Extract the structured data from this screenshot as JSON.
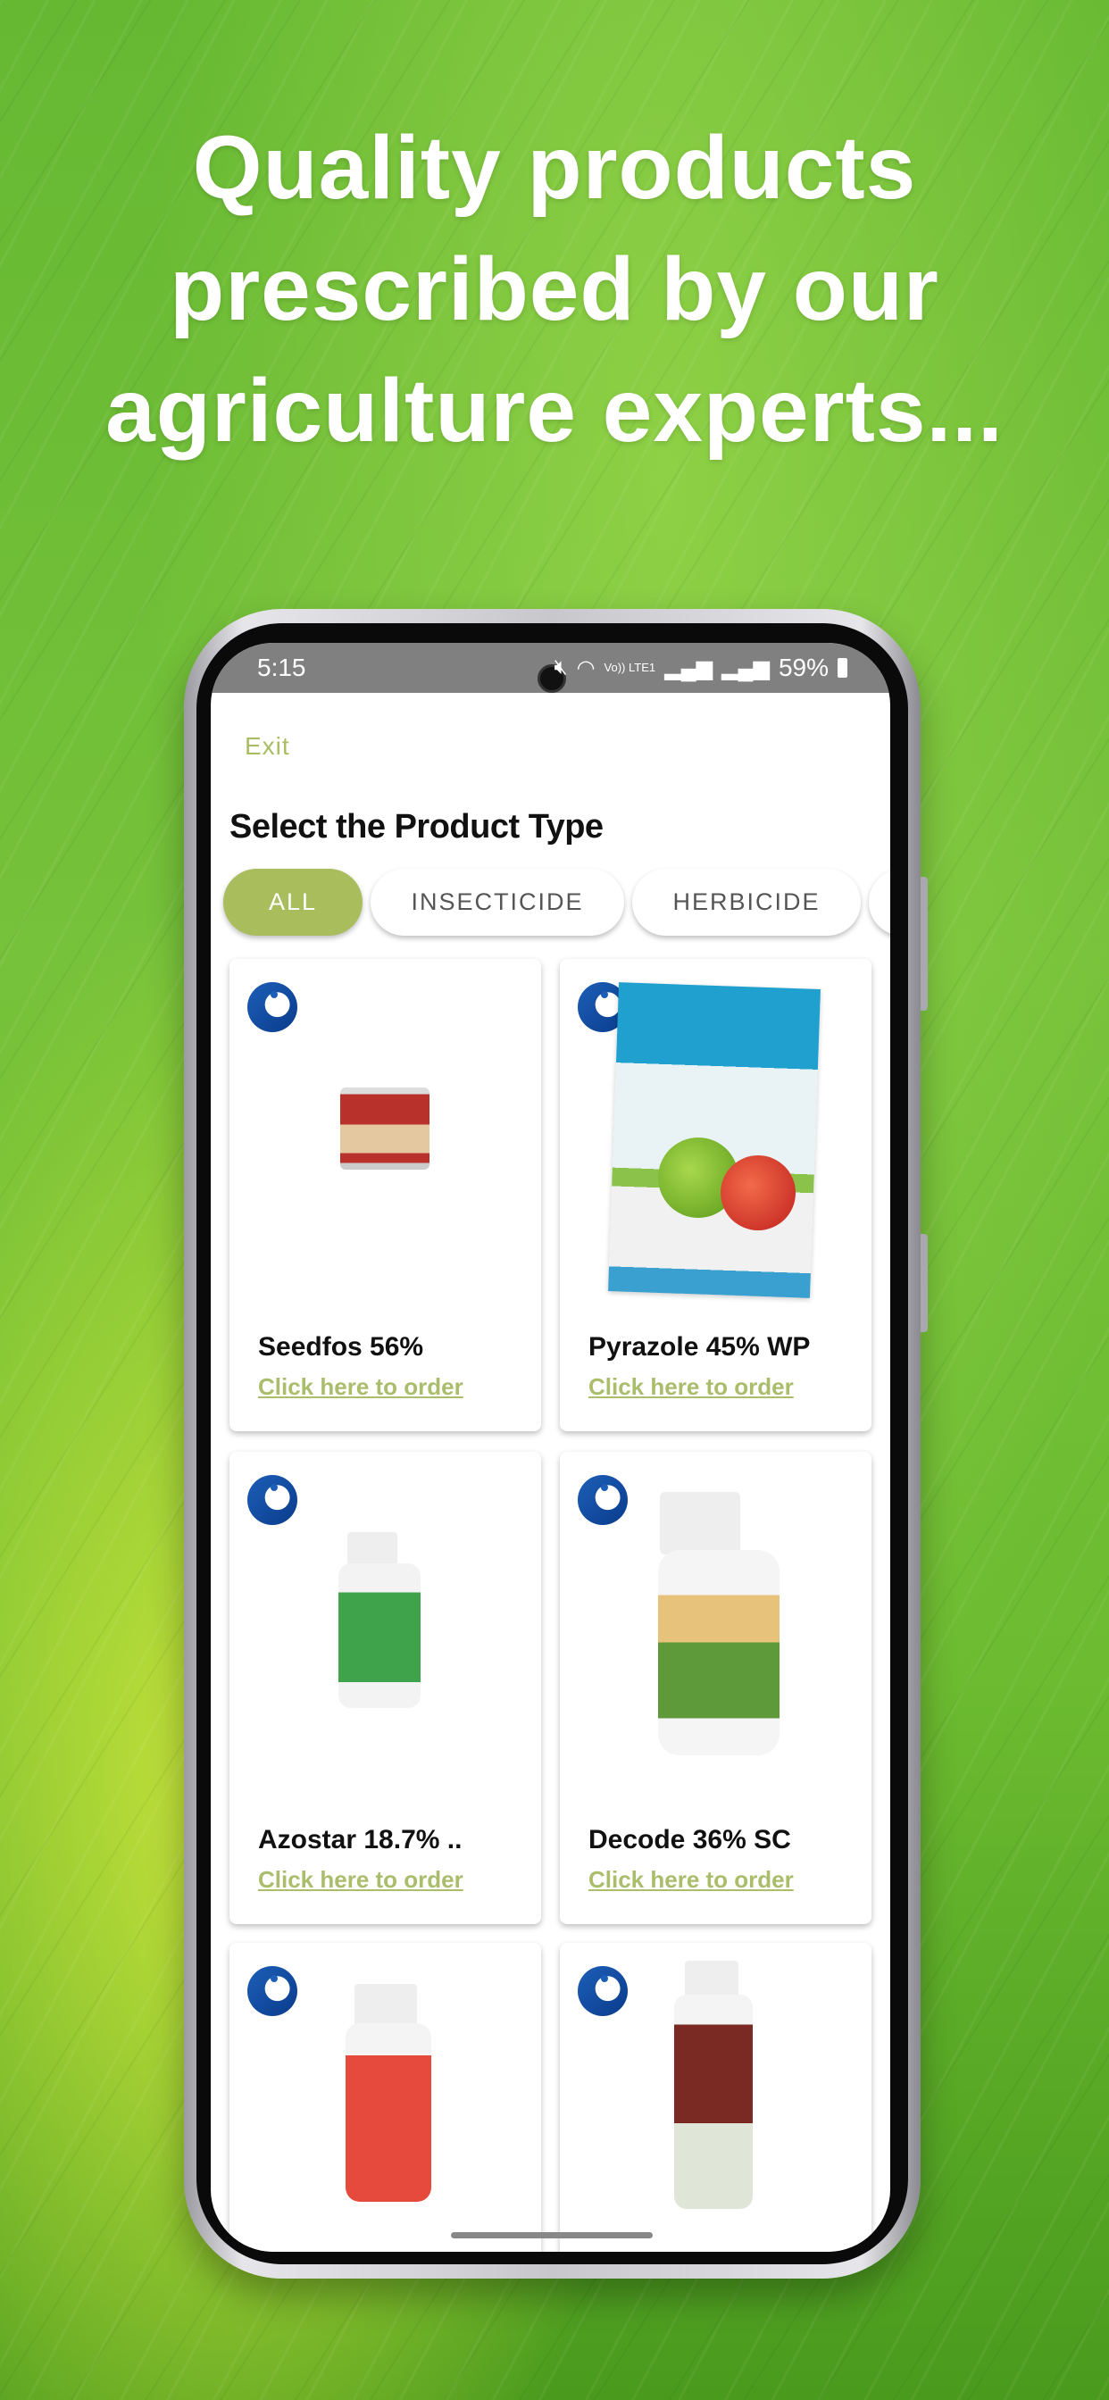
{
  "headline": [
    "Quality products",
    "prescribed by our",
    "agriculture experts..."
  ],
  "status_bar": {
    "time": "5:15",
    "network": "Vo)) LTE1",
    "battery": "59%"
  },
  "app": {
    "exit_label": "Exit",
    "title": "Select the Product Type",
    "chips": [
      {
        "label": "ALL",
        "selected": true
      },
      {
        "label": "INSECTICIDE",
        "selected": false
      },
      {
        "label": "HERBICIDE",
        "selected": false
      }
    ],
    "products": [
      {
        "name": "Seedfos 56%",
        "link": "Click here to order"
      },
      {
        "name": "Pyrazole 45% WP",
        "link": "Click here to order"
      },
      {
        "name": "Azostar 18.7% ..",
        "link": "Click here to order"
      },
      {
        "name": "Decode 36% SC",
        "link": "Click here to order"
      },
      {
        "name": "",
        "link": ""
      },
      {
        "name": "",
        "link": ""
      }
    ]
  },
  "colors": {
    "accent": "#a9bd5d",
    "status_bar": "#808080",
    "link": "#a9bd6b"
  }
}
